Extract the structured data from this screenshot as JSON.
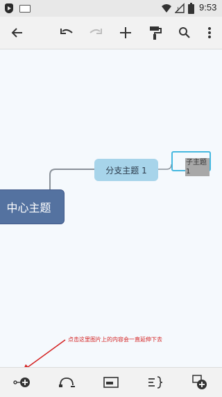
{
  "status_bar": {
    "time": "9:53",
    "icons": [
      "app-icon",
      "keyboard-icon",
      "wifi-icon",
      "signal-icon",
      "battery-icon"
    ]
  },
  "toolbar": {
    "icons": [
      "back-arrow-icon",
      "undo-icon",
      "redo-icon",
      "add-icon",
      "format-paint-icon",
      "search-icon",
      "more-vert-icon"
    ],
    "redo_enabled": false
  },
  "mindmap": {
    "central_topic": "中心主题",
    "main_topic": "分支主题 1",
    "sub_topic": "子主题 1",
    "colors": {
      "central": "#5472a0",
      "main": "#a7d4ea",
      "selection": "#45b8e0",
      "connector": "#8a9199"
    }
  },
  "annotation": {
    "text": "点击这里图片上的内容会一直延伸下去",
    "color": "#d42020"
  },
  "bottom_bar": {
    "icons": [
      "add-node-icon",
      "relationship-icon",
      "callout-icon",
      "summary-icon",
      "add-floating-topic-icon"
    ]
  }
}
